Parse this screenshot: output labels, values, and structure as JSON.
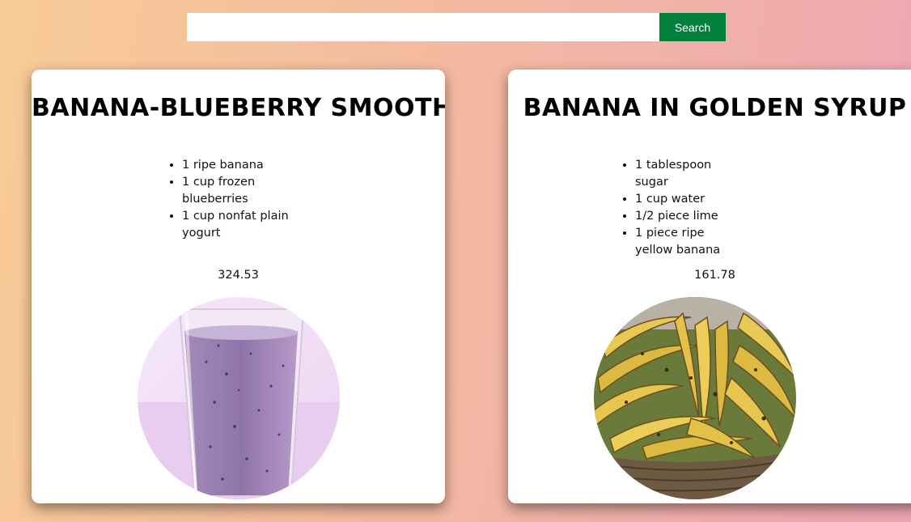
{
  "search": {
    "value": "",
    "placeholder": "",
    "button_label": "Search"
  },
  "recipes": [
    {
      "title": "BANANA-BLUEBERRY SMOOTHIE",
      "ingredients": [
        "1 ripe banana",
        "1 cup frozen blueberries",
        "1 cup nonfat plain yogurt"
      ],
      "calories": "324.53",
      "image": "blueberry-smoothie-glass"
    },
    {
      "title": "BANANA IN GOLDEN SYRUP",
      "ingredients": [
        "1 tablespoon sugar",
        "1 cup water",
        "1/2 piece lime",
        "1 piece ripe yellow banana"
      ],
      "calories": "161.78",
      "image": "banana-basket"
    }
  ],
  "colors": {
    "search_button": "#007f3d",
    "background_start": "#f8cb96",
    "background_end": "#eca6b2"
  }
}
